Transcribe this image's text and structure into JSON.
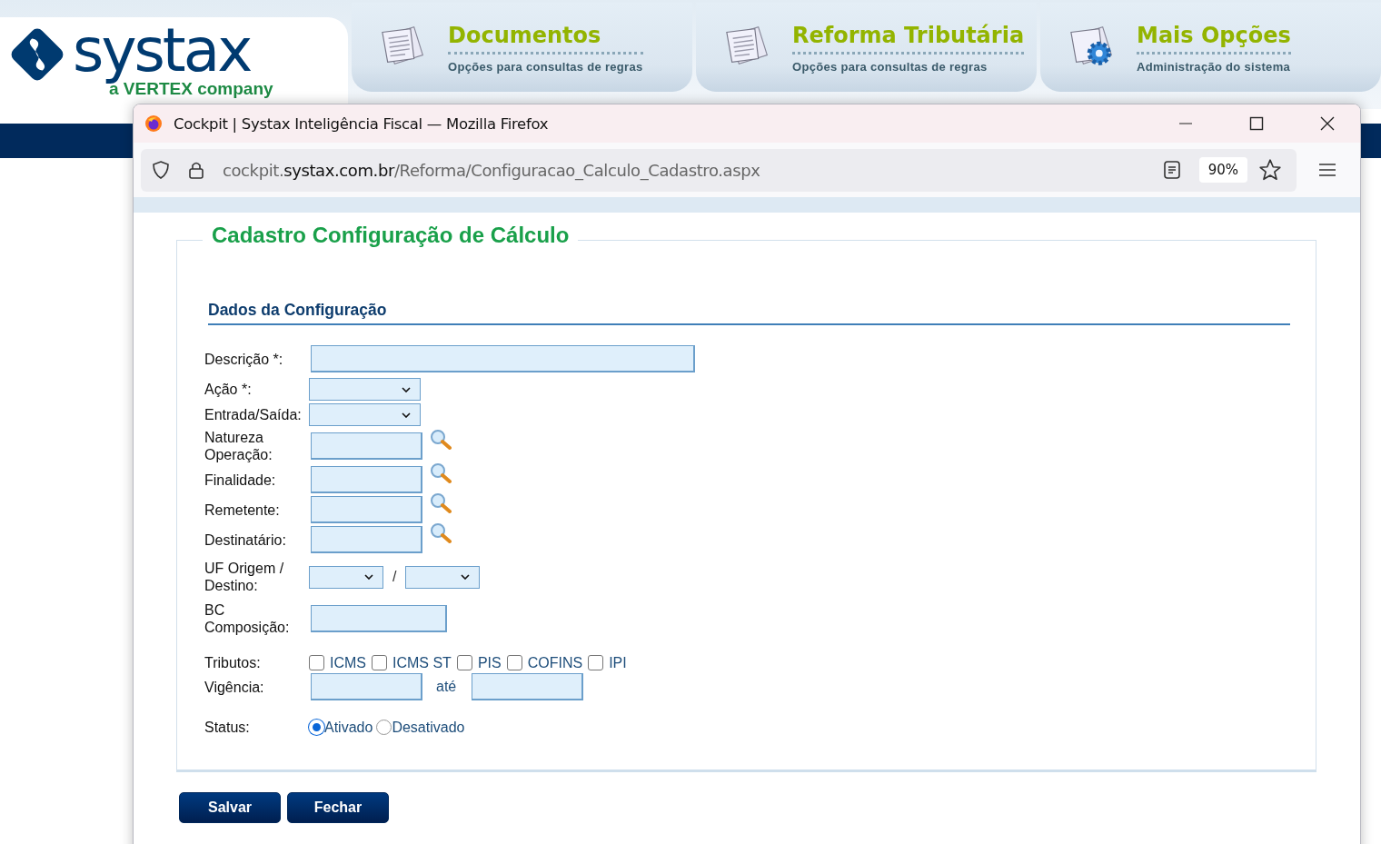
{
  "background_page": {
    "logo": {
      "name": "systax",
      "tagline": "a VERTEX company"
    },
    "nav_items": [
      {
        "kind": "documents",
        "title": "Documentos",
        "subtitle": "Opções para consultas de regras"
      },
      {
        "kind": "documents",
        "title": "Reforma Tributária",
        "subtitle": "Opções para consultas de regras"
      },
      {
        "kind": "gear",
        "title": "Mais Opções",
        "subtitle": "Administração do sistema"
      }
    ]
  },
  "browser": {
    "title": "Cockpit | Systax Inteligência Fiscal — Mozilla Firefox",
    "url": {
      "subdomain": "cockpit.",
      "domain": "systax.com.br",
      "path": "/Reforma/Configuracao_Calculo_Cadastro.aspx"
    },
    "zoom": "90%"
  },
  "form": {
    "title": "Cadastro Configuração de Cálculo",
    "section_title": "Dados da Configuração",
    "fields": [
      {
        "kind": "wide_text",
        "label": "Descrição *:"
      },
      {
        "kind": "select",
        "label": "Ação *:"
      },
      {
        "kind": "select",
        "label": "Entrada/Saída:"
      },
      {
        "kind": "lookup",
        "label": "Natureza Operação:"
      },
      {
        "kind": "lookup",
        "label": "Finalidade:"
      },
      {
        "kind": "lookup",
        "label": "Remetente:"
      },
      {
        "kind": "lookup",
        "label": "Destinatário:"
      },
      {
        "kind": "select_pair",
        "label": "UF Origem / Destino:",
        "separator": "/"
      },
      {
        "kind": "text",
        "label": "BC Composição:"
      },
      {
        "kind": "checkboxes",
        "label": "Tributos:",
        "options": [
          {
            "label": "ICMS",
            "checked": false
          },
          {
            "label": "ICMS ST",
            "checked": false
          },
          {
            "label": "PIS",
            "checked": false
          },
          {
            "label": "COFINS",
            "checked": false
          },
          {
            "label": "IPI",
            "checked": false
          }
        ]
      },
      {
        "kind": "date_range",
        "label": "Vigência:",
        "separator": "até"
      },
      {
        "kind": "radio",
        "label": "Status:",
        "options": [
          {
            "label": "Ativado",
            "selected": true
          },
          {
            "label": "Desativado",
            "selected": false
          }
        ]
      }
    ]
  },
  "buttons": [
    "Salvar",
    "Fechar"
  ]
}
